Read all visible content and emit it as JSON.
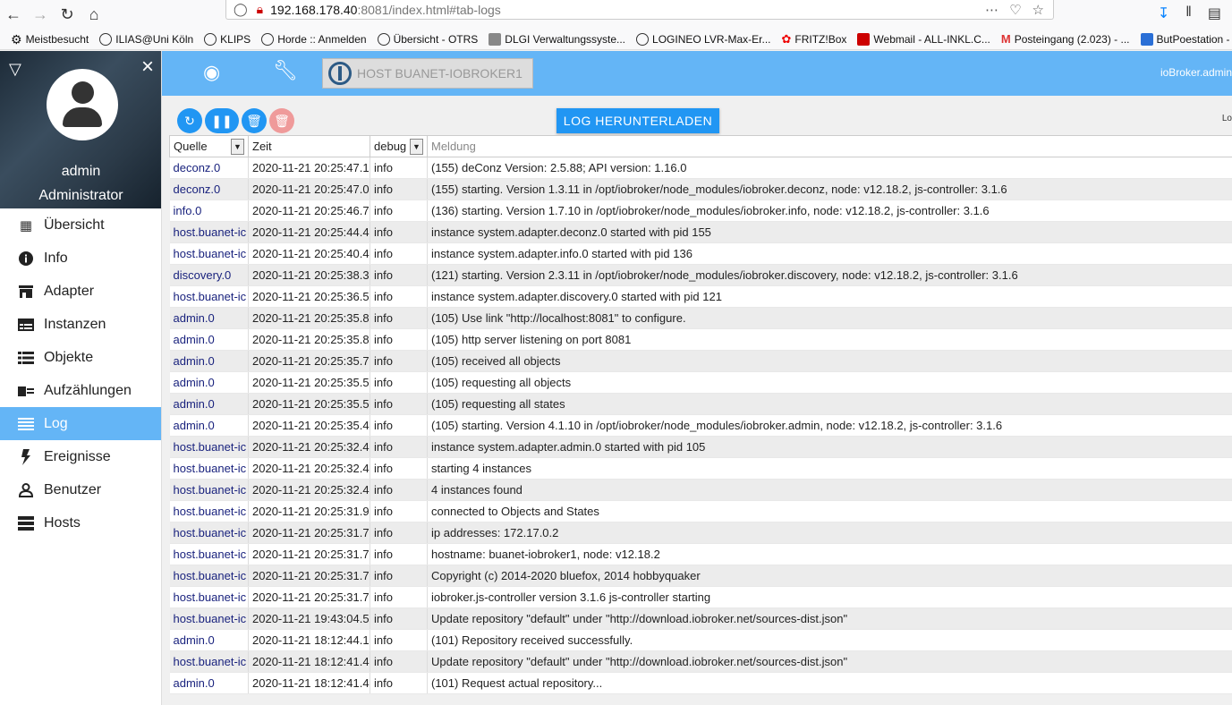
{
  "browser": {
    "url_host": "192.168.178.40",
    "url_rest": ":8081/index.html#tab-logs",
    "bookmarks": [
      "Meistbesucht",
      "ILIAS@Uni Köln",
      "KLIPS",
      "Horde :: Anmelden",
      "Übersicht - OTRS",
      "DLGI Verwaltungssyste...",
      "LOGINEO LVR-Max-Er...",
      "FRITZ!Box",
      "Webmail - ALL-INKL.C...",
      "Posteingang (2.023) - ...",
      "ButPoestation - ..."
    ]
  },
  "sidebar": {
    "user_name": "admin",
    "user_role": "Administrator",
    "items": [
      {
        "label": "Übersicht",
        "icon": "grid-icon"
      },
      {
        "label": "Info",
        "icon": "info-icon"
      },
      {
        "label": "Adapter",
        "icon": "store-icon"
      },
      {
        "label": "Instanzen",
        "icon": "instances-icon"
      },
      {
        "label": "Objekte",
        "icon": "list-icon"
      },
      {
        "label": "Aufzählungen",
        "icon": "enum-icon"
      },
      {
        "label": "Log",
        "icon": "log-icon",
        "active": true
      },
      {
        "label": "Ereignisse",
        "icon": "flash-icon"
      },
      {
        "label": "Benutzer",
        "icon": "user-icon"
      },
      {
        "label": "Hosts",
        "icon": "hosts-icon"
      }
    ]
  },
  "topbar": {
    "host_label": "HOST BUANET-IOBROKER1",
    "user_right": "ioBroker.admin"
  },
  "toolbar": {
    "download_label": "LOG HERUNTERLADEN",
    "lo_label": "Lo"
  },
  "table": {
    "headers": {
      "source": "Quelle",
      "time": "Zeit",
      "level": "debug",
      "message_placeholder": "Meldung"
    },
    "rows": [
      {
        "source": "deconz.0",
        "time": "2020-11-21 20:25:47.1",
        "level": "info",
        "message": "(155) deConz Version: 2.5.88; API version: 1.16.0"
      },
      {
        "source": "deconz.0",
        "time": "2020-11-21 20:25:47.0",
        "level": "info",
        "message": "(155) starting. Version 1.3.11 in /opt/iobroker/node_modules/iobroker.deconz, node: v12.18.2, js-controller: 3.1.6"
      },
      {
        "source": "info.0",
        "time": "2020-11-21 20:25:46.7",
        "level": "info",
        "message": "(136) starting. Version 1.7.10 in /opt/iobroker/node_modules/iobroker.info, node: v12.18.2, js-controller: 3.1.6"
      },
      {
        "source": "host.buanet-ic",
        "time": "2020-11-21 20:25:44.4",
        "level": "info",
        "message": "instance system.adapter.deconz.0 started with pid 155"
      },
      {
        "source": "host.buanet-ic",
        "time": "2020-11-21 20:25:40.4",
        "level": "info",
        "message": "instance system.adapter.info.0 started with pid 136"
      },
      {
        "source": "discovery.0",
        "time": "2020-11-21 20:25:38.3",
        "level": "info",
        "message": "(121) starting. Version 2.3.11 in /opt/iobroker/node_modules/iobroker.discovery, node: v12.18.2, js-controller: 3.1.6"
      },
      {
        "source": "host.buanet-ic",
        "time": "2020-11-21 20:25:36.5",
        "level": "info",
        "message": "instance system.adapter.discovery.0 started with pid 121"
      },
      {
        "source": "admin.0",
        "time": "2020-11-21 20:25:35.8",
        "level": "info",
        "message": "(105) Use link \"http://localhost:8081\" to configure."
      },
      {
        "source": "admin.0",
        "time": "2020-11-21 20:25:35.8",
        "level": "info",
        "message": "(105) http server listening on port 8081"
      },
      {
        "source": "admin.0",
        "time": "2020-11-21 20:25:35.7",
        "level": "info",
        "message": "(105) received all objects"
      },
      {
        "source": "admin.0",
        "time": "2020-11-21 20:25:35.5",
        "level": "info",
        "message": "(105) requesting all objects"
      },
      {
        "source": "admin.0",
        "time": "2020-11-21 20:25:35.5",
        "level": "info",
        "message": "(105) requesting all states"
      },
      {
        "source": "admin.0",
        "time": "2020-11-21 20:25:35.4",
        "level": "info",
        "message": "(105) starting. Version 4.1.10 in /opt/iobroker/node_modules/iobroker.admin, node: v12.18.2, js-controller: 3.1.6"
      },
      {
        "source": "host.buanet-ic",
        "time": "2020-11-21 20:25:32.4",
        "level": "info",
        "message": "instance system.adapter.admin.0 started with pid 105"
      },
      {
        "source": "host.buanet-ic",
        "time": "2020-11-21 20:25:32.4",
        "level": "info",
        "message": "starting 4 instances"
      },
      {
        "source": "host.buanet-ic",
        "time": "2020-11-21 20:25:32.4",
        "level": "info",
        "message": "4 instances found"
      },
      {
        "source": "host.buanet-ic",
        "time": "2020-11-21 20:25:31.9",
        "level": "info",
        "message": "connected to Objects and States"
      },
      {
        "source": "host.buanet-ic",
        "time": "2020-11-21 20:25:31.7",
        "level": "info",
        "message": "ip addresses: 172.17.0.2"
      },
      {
        "source": "host.buanet-ic",
        "time": "2020-11-21 20:25:31.7",
        "level": "info",
        "message": "hostname: buanet-iobroker1, node: v12.18.2"
      },
      {
        "source": "host.buanet-ic",
        "time": "2020-11-21 20:25:31.7",
        "level": "info",
        "message": "Copyright (c) 2014-2020 bluefox, 2014 hobbyquaker"
      },
      {
        "source": "host.buanet-ic",
        "time": "2020-11-21 20:25:31.7",
        "level": "info",
        "message": "iobroker.js-controller version 3.1.6 js-controller starting"
      },
      {
        "source": "host.buanet-ic",
        "time": "2020-11-21 19:43:04.5",
        "level": "info",
        "message": "Update repository \"default\" under \"http://download.iobroker.net/sources-dist.json\""
      },
      {
        "source": "admin.0",
        "time": "2020-11-21 18:12:44.1",
        "level": "info",
        "message": "(101) Repository received successfully."
      },
      {
        "source": "host.buanet-ic",
        "time": "2020-11-21 18:12:41.4",
        "level": "info",
        "message": "Update repository \"default\" under \"http://download.iobroker.net/sources-dist.json\""
      },
      {
        "source": "admin.0",
        "time": "2020-11-21 18:12:41.4",
        "level": "info",
        "message": "(101) Request actual repository..."
      }
    ]
  },
  "colors": {
    "accent": "#64b5f6",
    "button": "#2196f3",
    "disabled": "#ef9a9a",
    "source_text": "#1a237e"
  }
}
